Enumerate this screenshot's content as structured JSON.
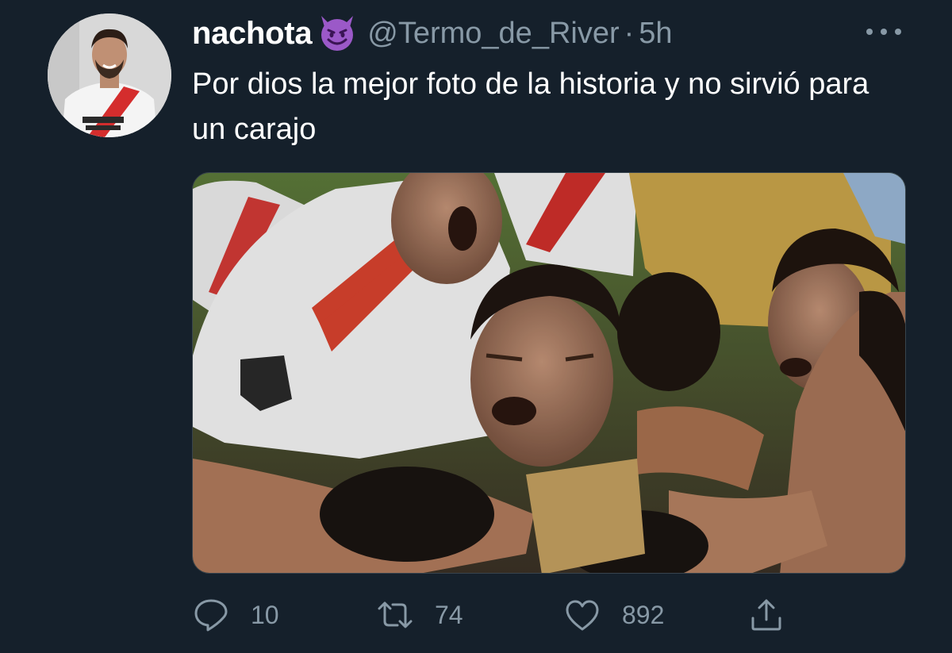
{
  "tweet": {
    "display_name": "nachota",
    "name_emoji": "smiling-face-with-horns",
    "handle": "@Termo_de_River",
    "separator": "·",
    "time": "5h",
    "text": "Por dios la mejor foto de la historia y no sirvió para un carajo",
    "media_alt": "photo of River Plate players celebrating"
  },
  "actions": {
    "reply": {
      "icon": "reply-icon",
      "count": "10"
    },
    "retweet": {
      "icon": "retweet-icon",
      "count": "74"
    },
    "like": {
      "icon": "heart-icon",
      "count": "892"
    },
    "share": {
      "icon": "share-icon"
    }
  },
  "colors": {
    "background": "#15202b",
    "secondary_text": "#8899a6",
    "primary_text": "#ffffff",
    "emoji_purple": "#9b59c8"
  }
}
